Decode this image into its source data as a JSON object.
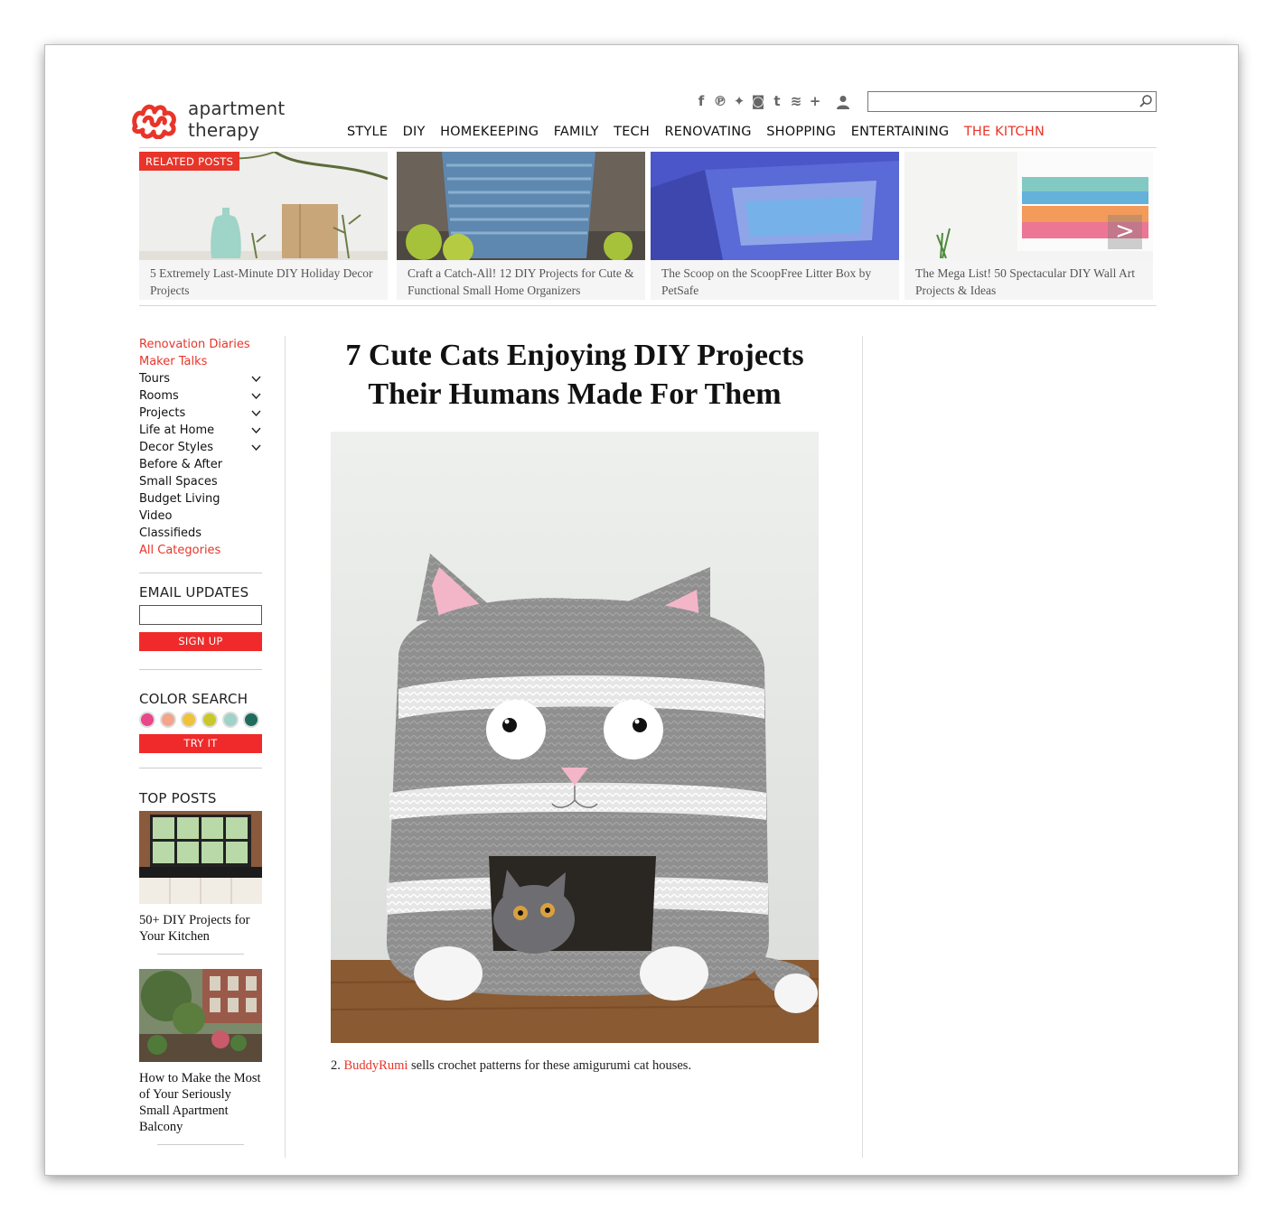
{
  "brand": {
    "name_line1": "apartment",
    "name_line2": "therapy",
    "accent": "#e8352a"
  },
  "social_icons": [
    "facebook-icon",
    "pinterest-icon",
    "twitter-icon",
    "instagram-icon",
    "tumblr-icon",
    "rss-icon",
    "plus-icon"
  ],
  "search": {
    "value": "",
    "placeholder": ""
  },
  "topnav": [
    {
      "label": "STYLE"
    },
    {
      "label": "DIY"
    },
    {
      "label": "HOMEKEEPING"
    },
    {
      "label": "FAMILY"
    },
    {
      "label": "TECH"
    },
    {
      "label": "RENOVATING"
    },
    {
      "label": "SHOPPING"
    },
    {
      "label": "ENTERTAINING"
    },
    {
      "label": "THE KITCHN"
    }
  ],
  "related": {
    "label": "RELATED POSTS",
    "items": [
      {
        "caption": "5 Extremely Last-Minute DIY Holiday Decor Projects"
      },
      {
        "caption": "Craft a Catch-All! 12 DIY Projects for Cute & Functional Small Home Organizers"
      },
      {
        "caption": "The Scoop on the ScoopFree Litter Box by PetSafe"
      },
      {
        "caption": "The Mega List! 50 Spectacular DIY Wall Art Projects & Ideas"
      }
    ],
    "next_label": ">"
  },
  "sidebar": {
    "categories": [
      {
        "label": "Renovation Diaries",
        "red": true,
        "chevron": false
      },
      {
        "label": "Maker Talks",
        "red": true,
        "chevron": false
      },
      {
        "label": "Tours",
        "red": false,
        "chevron": true
      },
      {
        "label": "Rooms",
        "red": false,
        "chevron": true
      },
      {
        "label": "Projects",
        "red": false,
        "chevron": true
      },
      {
        "label": "Life at Home",
        "red": false,
        "chevron": true
      },
      {
        "label": "Decor Styles",
        "red": false,
        "chevron": true
      },
      {
        "label": "Before & After",
        "red": false,
        "chevron": false
      },
      {
        "label": "Small Spaces",
        "red": false,
        "chevron": false
      },
      {
        "label": "Budget Living",
        "red": false,
        "chevron": false
      },
      {
        "label": "Video",
        "red": false,
        "chevron": false
      },
      {
        "label": "Classifieds",
        "red": false,
        "chevron": false
      },
      {
        "label": "All Categories",
        "red": true,
        "chevron": false
      }
    ],
    "email": {
      "heading": "EMAIL UPDATES",
      "value": "",
      "button": "SIGN UP"
    },
    "color_search": {
      "heading": "COLOR SEARCH",
      "swatches": [
        "#e8478a",
        "#f2a58a",
        "#f0c23b",
        "#c9c82a",
        "#9fd2c8",
        "#1f6b5e"
      ],
      "button": "TRY IT"
    },
    "top_posts": {
      "heading": "TOP POSTS",
      "items": [
        {
          "title": "50+ DIY Projects for Your Kitchen"
        },
        {
          "title": "How to Make the Most of Your Seriously Small Apartment Balcony"
        }
      ]
    }
  },
  "article": {
    "title": "7 Cute Cats Enjoying DIY Projects Their Humans Made For Them",
    "caption_number": "2.",
    "caption_link": "BuddyRumi",
    "caption_text": " sells crochet patterns for these amigurumi cat houses."
  }
}
